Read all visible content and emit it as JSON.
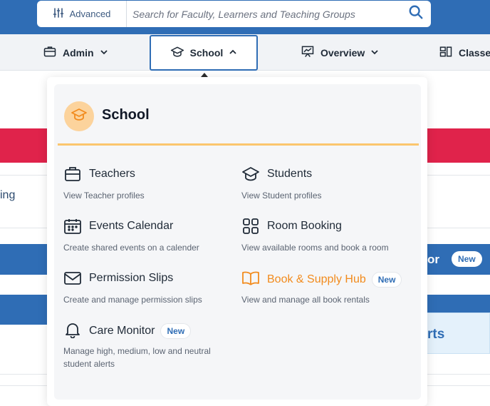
{
  "search": {
    "advanced_label": "Advanced",
    "placeholder": "Search for Faculty, Learners and Teaching Groups"
  },
  "nav": {
    "admin": "Admin",
    "school": "School",
    "overview": "Overview",
    "classes": "Classes"
  },
  "background": {
    "row_text": "ing",
    "banner_text": "or",
    "banner_badge": "New",
    "alerts_text": "rts"
  },
  "dropdown": {
    "title": "School",
    "accent_color": "#fbc66e",
    "items": [
      {
        "label": "Teachers",
        "description": "View Teacher profiles",
        "icon": "briefcase-icon"
      },
      {
        "label": "Students",
        "description": "View Student profiles",
        "icon": "graduation-cap-icon"
      },
      {
        "label": "Events Calendar",
        "description": "Create shared events on a calender",
        "icon": "calendar-icon"
      },
      {
        "label": "Room Booking",
        "description": "View available rooms and book a room",
        "icon": "grid-icon"
      },
      {
        "label": "Permission Slips",
        "description": "Create and manage permission slips",
        "icon": "envelope-icon"
      },
      {
        "label": "Book & Supply Hub",
        "description": "View and manage all book rentals",
        "icon": "open-book-icon",
        "badge": "New",
        "color": "#f28b1d"
      },
      {
        "label": "Care Monitor",
        "description": "Manage high, medium, low and neutral student alerts",
        "icon": "bell-icon",
        "badge": "New"
      }
    ]
  },
  "colors": {
    "brand_blue": "#2f6db5",
    "red_banner": "#e0234b"
  }
}
